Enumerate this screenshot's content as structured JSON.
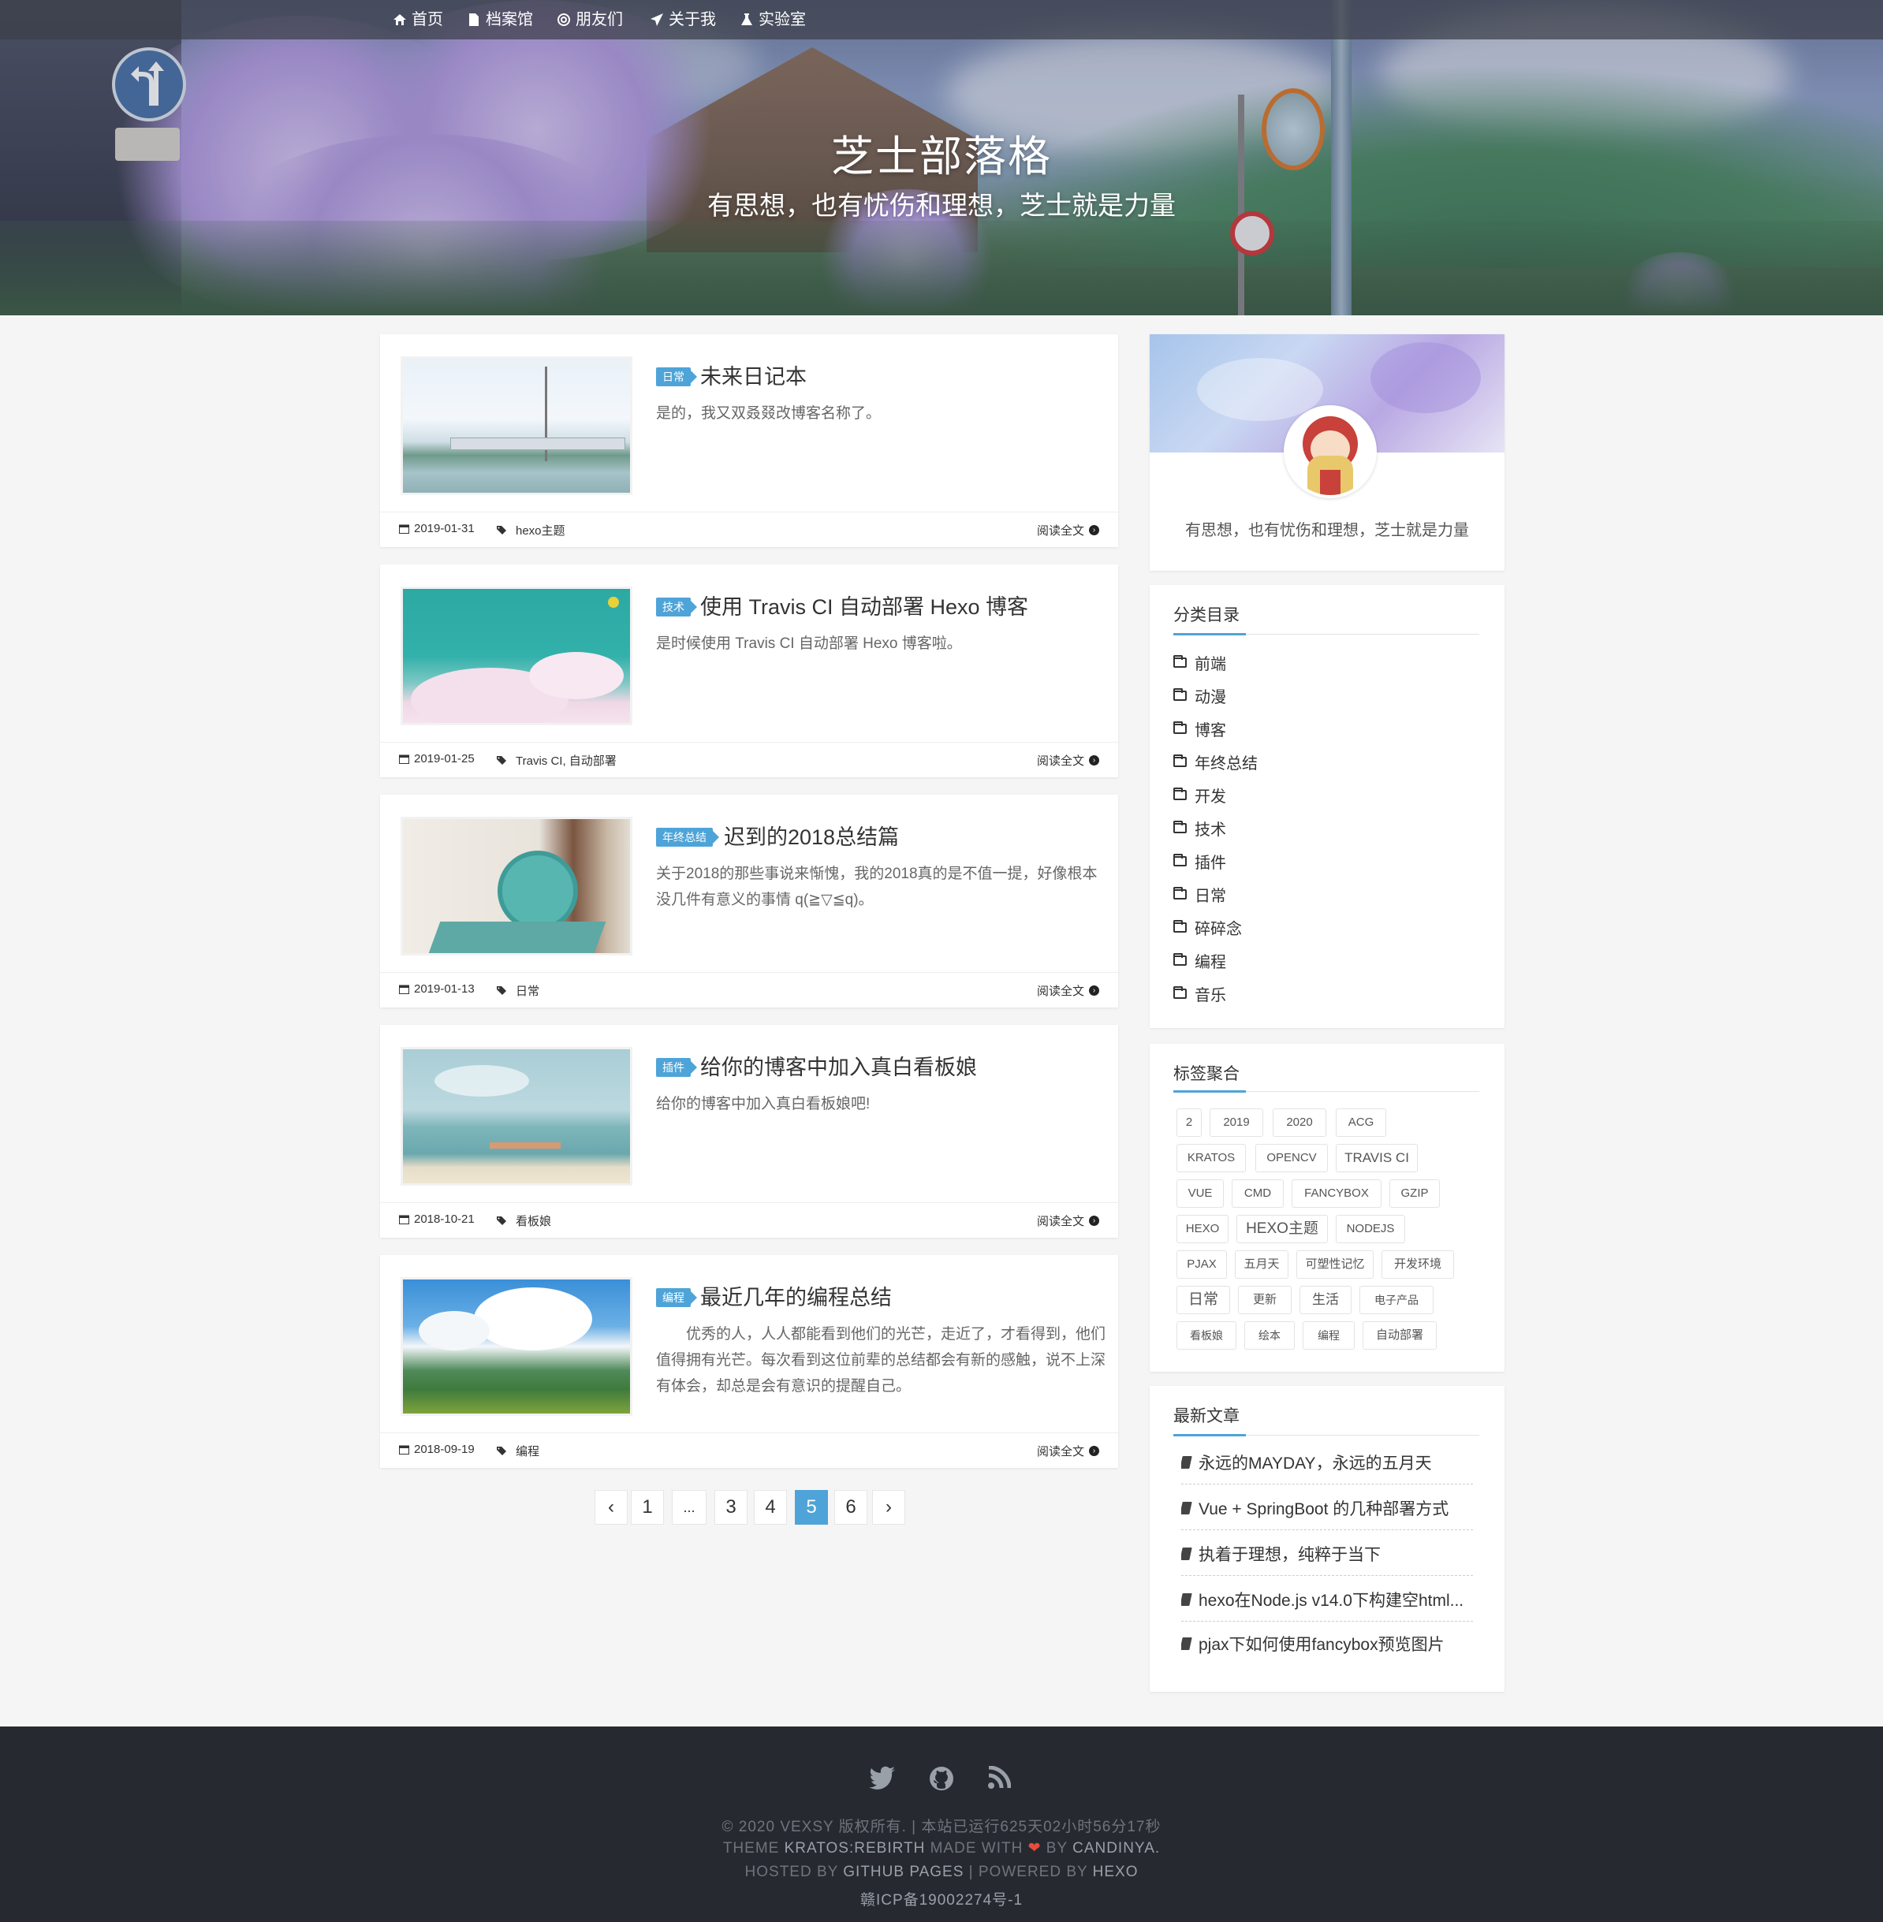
{
  "nav": {
    "items": [
      {
        "label": "首页",
        "icon": "home-icon"
      },
      {
        "label": "档案馆",
        "icon": "file-icon"
      },
      {
        "label": "朋友们",
        "icon": "link-icon"
      },
      {
        "label": "关于我",
        "icon": "paper-plane-icon"
      },
      {
        "label": "实验室",
        "icon": "flask-icon"
      }
    ]
  },
  "hero": {
    "title": "芝士部落格",
    "subtitle": "有思想，也有忧伤和理想，芝士就是力量"
  },
  "posts": [
    {
      "category": "日常",
      "title": "未来日记本",
      "excerpt": "是的，我又双叒叕改博客名称了。",
      "date": "2019-01-31",
      "tags": "hexo主题",
      "read_more": "阅读全文"
    },
    {
      "category": "技术",
      "title": "使用 Travis CI 自动部署 Hexo 博客",
      "excerpt": "是时候使用 Travis CI 自动部署 Hexo 博客啦。",
      "date": "2019-01-25",
      "tags": "Travis CI, 自动部署",
      "read_more": "阅读全文"
    },
    {
      "category": "年终总结",
      "title": "迟到的2018总结篇",
      "excerpt": "关于2018的那些事说来惭愧，我的2018真的是不值一提，好像根本没几件有意义的事情 q(≧▽≦q)。",
      "date": "2019-01-13",
      "tags": "日常",
      "read_more": "阅读全文"
    },
    {
      "category": "插件",
      "title": "给你的博客中加入真白看板娘",
      "excerpt": "给你的博客中加入真白看板娘吧!",
      "date": "2018-10-21",
      "tags": "看板娘",
      "read_more": "阅读全文"
    },
    {
      "category": "编程",
      "title": "最近几年的编程总结",
      "excerpt": "优秀的人，人人都能看到他们的光芒，走近了，才看得到，他们值得拥有光芒。每次看到这位前辈的总结都会有新的感触，说不上深有体会，却总是会有意识的提醒自己。",
      "date": "2018-09-19",
      "tags": "编程",
      "read_more": "阅读全文"
    }
  ],
  "pagination": {
    "prev": "‹",
    "next": "›",
    "pages": [
      "1",
      "...",
      "3",
      "4",
      "5",
      "6"
    ],
    "current": "5"
  },
  "profile": {
    "motto": "有思想，也有忧伤和理想，芝士就是力量"
  },
  "categories": {
    "title": "分类目录",
    "items": [
      "前端",
      "动漫",
      "博客",
      "年终总结",
      "开发",
      "技术",
      "插件",
      "日常",
      "碎碎念",
      "编程",
      "音乐"
    ]
  },
  "tags": {
    "title": "标签聚合",
    "items": [
      "2",
      "2019",
      "2020",
      "ACG",
      "KRATOS",
      "OPENCV",
      "TRAVIS CI",
      "VUE",
      "CMD",
      "FANCYBOX",
      "GZIP",
      "HEXO",
      "HEXO主题",
      "NODEJS",
      "PJAX",
      "五月天",
      "可塑性记忆",
      "开发环境",
      "日常",
      "更新",
      "生活",
      "电子产品",
      "看板娘",
      "绘本",
      "编程",
      "自动部署"
    ]
  },
  "recent": {
    "title": "最新文章",
    "items": [
      "永远的MAYDAY，永远的五月天",
      "Vue + SpringBoot 的几种部署方式",
      "执着于理想，纯粹于当下",
      "hexo在Node.js v14.0下构建空html...",
      "pjax下如何使用fancybox预览图片"
    ]
  },
  "footer": {
    "line1": "© 2020 VEXSY 版权所有. | 本站已运行625天02小时56分17秒",
    "line2_a": "THEME",
    "line2_b": "KRATOS:REBIRTH",
    "line2_c": "MADE WITH",
    "line2_d": "BY",
    "line2_e": "CANDINYA.",
    "line3_a": "HOSTED BY",
    "line3_b": "GITHUB PAGES",
    "line3_c": "| POWERED BY",
    "line3_d": "HEXO",
    "line4": "赣ICP备19002274号-1",
    "social_icons": [
      "twitter-icon",
      "github-icon",
      "rss-icon"
    ]
  },
  "colors": {
    "accent": "#4ea4d8",
    "footer_bg": "#262a30",
    "heart": "#e74c3c"
  }
}
